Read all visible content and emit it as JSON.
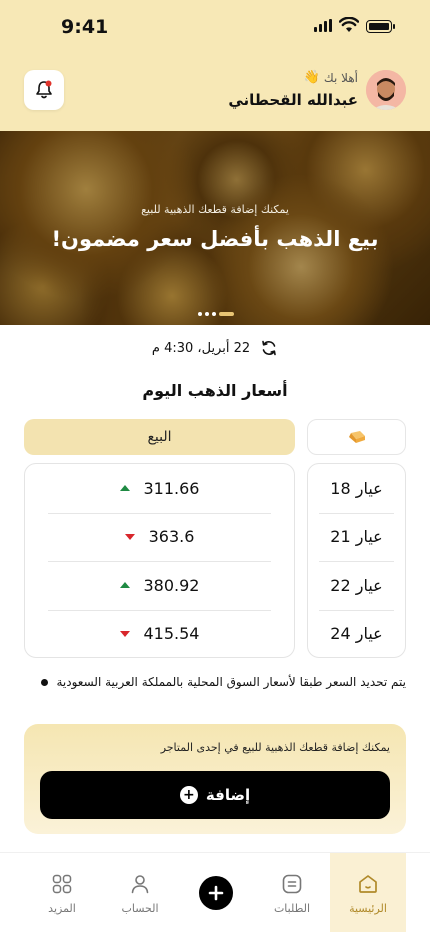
{
  "status_bar": {
    "time": "9:41"
  },
  "header": {
    "greeting": "أهلا بك",
    "user_name": "عبدالله القحطاني",
    "wave_icon": "wave-hand-icon",
    "bell_icon": "bell-icon"
  },
  "banner": {
    "subtitle": "يمكنك إضافة قطعك الذهبية للبيع",
    "headline": "بيع الذهب بأفضل سعر مضمون!",
    "slides_count": 4,
    "active_slide": 4
  },
  "prices": {
    "updated_at": "22 أبريل، 4:30 م",
    "title": "أسعار الذهب اليوم",
    "sell_header": "البيع",
    "rows": [
      {
        "karat": "عيار 18",
        "price": "311.66",
        "trend": "up"
      },
      {
        "karat": "عيار 21",
        "price": "363.6",
        "trend": "down"
      },
      {
        "karat": "عيار 22",
        "price": "380.92",
        "trend": "up"
      },
      {
        "karat": "عيار 24",
        "price": "415.54",
        "trend": "down"
      }
    ],
    "note": "يتم تحديد السعر طبقا لأسعار السوق المحلية بالمملكة العربية السعودية"
  },
  "add_card": {
    "text": "يمكنك إضافة قطعك الذهبية للبيع في إحدى المتاجر",
    "button_label": "إضافة"
  },
  "nav": {
    "home": "الرئيسية",
    "orders": "الطلبات",
    "account": "الحساب",
    "more": "المزيد"
  },
  "colors": {
    "header_bg": "#f7e8b6",
    "accent_gold": "#b08a2a",
    "trend_up": "#1f8a43",
    "trend_down": "#d8262c",
    "primary_button": "#000000"
  }
}
